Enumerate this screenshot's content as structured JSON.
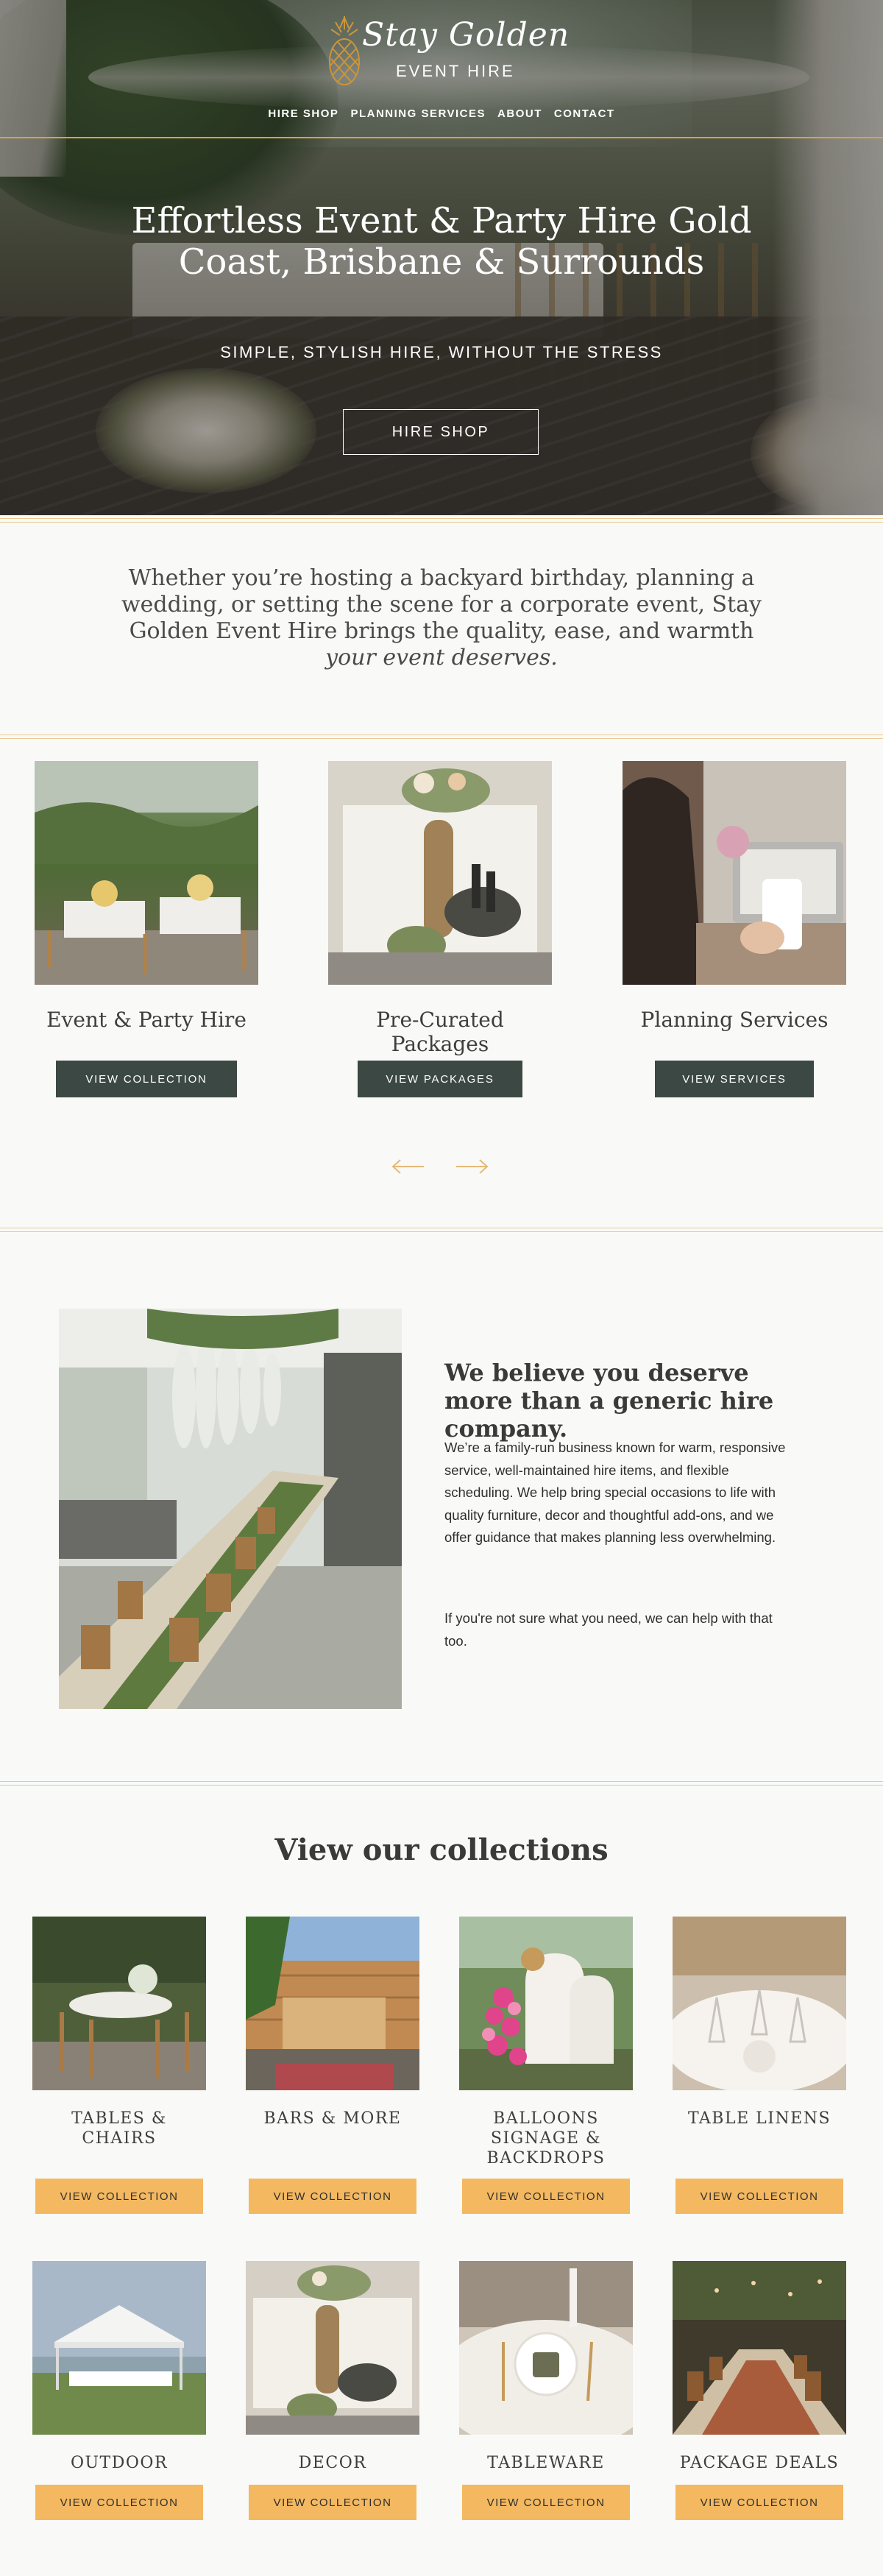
{
  "brand": {
    "script": "Stay Golden",
    "sub": "EVENT HIRE"
  },
  "nav": {
    "items": [
      "HIRE SHOP",
      "PLANNING SERVICES",
      "ABOUT",
      "CONTACT"
    ]
  },
  "hero": {
    "title": "Effortless Event & Party Hire Gold Coast, Brisbane & Surrounds",
    "tagline": "SIMPLE, STYLISH HIRE, WITHOUT THE STRESS",
    "button": "HIRE SHOP"
  },
  "intro": {
    "text": "Whether you’re hosting a backyard birthday, planning a wedding, or setting the scene for a corporate event, Stay Golden Event Hire brings the quality, ease, and warmth ",
    "emphasis": "your event deserves."
  },
  "services": [
    {
      "title": "Event & Party Hire",
      "button": "VIEW COLLECTION"
    },
    {
      "title": "Pre-Curated Packages",
      "button": "VIEW PACKAGES"
    },
    {
      "title": "Planning Services",
      "button": "VIEW SERVICES"
    }
  ],
  "about": {
    "title": "We believe you deserve more than a generic hire company.",
    "p1": "We’re a family-run business known for warm, responsive service, well-maintained hire items, and flexible scheduling. We help bring special occasions to life with quality furniture, decor and thoughtful add-ons, and we offer guidance that makes planning less overwhelming.",
    "p2": "If you're not sure what you need, we can help with that too."
  },
  "collections": {
    "title": "View our collections",
    "button": "VIEW COLLECTION",
    "items": [
      {
        "name": "TABLES & CHAIRS"
      },
      {
        "name": "BARS & MORE"
      },
      {
        "name": "BALLOONS SIGNAGE & BACKDROPS"
      },
      {
        "name": "TABLE LINENS"
      },
      {
        "name": "OUTDOOR"
      },
      {
        "name": "DECOR"
      },
      {
        "name": "TABLEWARE"
      },
      {
        "name": "PACKAGE DEALS"
      }
    ]
  },
  "colors": {
    "gold": "#d9a441",
    "gold_light": "#ecc88f",
    "button_dark": "#3b4843",
    "button_gold": "#f3b860"
  },
  "icons": [
    "pineapple-logo-icon",
    "arrow-left-icon",
    "arrow-right-icon"
  ]
}
